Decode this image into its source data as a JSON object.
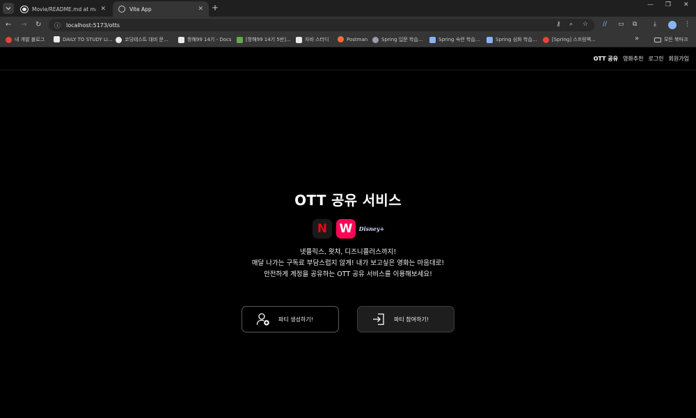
{
  "browser": {
    "tabs": [
      {
        "title": "Movie/README.md at master",
        "close": "✕"
      },
      {
        "title": "Vite App",
        "close": "✕"
      }
    ],
    "new_tab": "+",
    "url": "localhost:5173/otts",
    "bookmarks": [
      {
        "label": "내 개발 블로그",
        "color": "#ea4335"
      },
      {
        "label": "DAILY TO STUDY LI...",
        "color": "#e8eaed"
      },
      {
        "label": "코딩테스트 대비 문...",
        "color": "#e8eaed"
      },
      {
        "label": "항해99 14기 - Docs",
        "color": "#e8eaed"
      },
      {
        "label": "[항해99 14기 5반]...",
        "color": "#6aa84f"
      },
      {
        "label": "자바 스터디",
        "color": "#e8eaed"
      },
      {
        "label": "Postman",
        "color": "#ff6c37"
      },
      {
        "label": "Spring 입문 학습...",
        "color": "#9aa0a6"
      },
      {
        "label": "Spring 숙련 학습...",
        "color": "#8ab4f8"
      },
      {
        "label": "Spring 심화 학습...",
        "color": "#8ab4f8"
      },
      {
        "label": "[Spring] 스프링액...",
        "color": "#ea4335"
      }
    ],
    "bookmarks_more": "»",
    "all_bookmarks": "모든 북마크"
  },
  "site_nav": {
    "items": [
      {
        "label": "OTT 공유",
        "active": true
      },
      {
        "label": "영화추천",
        "active": false
      },
      {
        "label": "로그인",
        "active": false
      },
      {
        "label": "회원가입",
        "active": false
      }
    ]
  },
  "hero": {
    "title": "OTT 공유 서비스",
    "logos": [
      {
        "name": "netflix",
        "glyph": "N"
      },
      {
        "name": "watcha",
        "glyph": "W"
      },
      {
        "name": "disney-plus",
        "glyph": "Disney+"
      }
    ],
    "description": [
      "넷플릭스, 왓챠, 디즈니플러스까지!",
      "매달 나가는 구독료 부담스럽지 않게! 내가 보고싶은 영화는 마음대로!",
      "안전하게 계정을 공유하는 OTT 공유 서비스를 이용해보세요!"
    ]
  },
  "actions": {
    "create_label": "파티 생성하기!",
    "join_label": "파티 참여하기!"
  }
}
